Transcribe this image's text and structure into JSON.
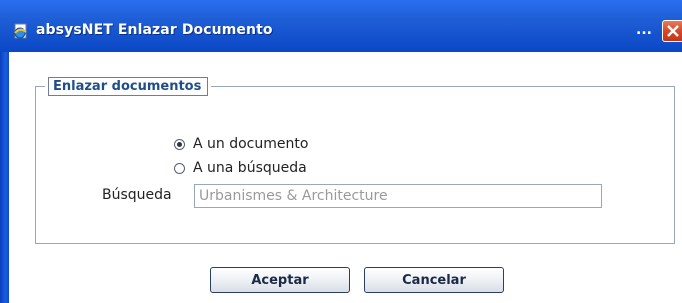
{
  "window": {
    "title": "absysNET Enlazar Documento",
    "title_overflow": "...",
    "app_icon": "ie-page-icon",
    "close_icon": "close-x-icon"
  },
  "form": {
    "legend": "Enlazar documentos",
    "options": [
      {
        "label": "A un documento",
        "checked": true
      },
      {
        "label": "A una búsqueda",
        "checked": false
      }
    ],
    "search": {
      "label": "Búsqueda",
      "value": "Urbanismes & Architecture"
    }
  },
  "buttons": {
    "accept": "Aceptar",
    "cancel": "Cancelar"
  },
  "colors": {
    "titlebar": "#1f5fd6",
    "legend_text": "#1f4e8a",
    "close_button": "#d8482a"
  }
}
